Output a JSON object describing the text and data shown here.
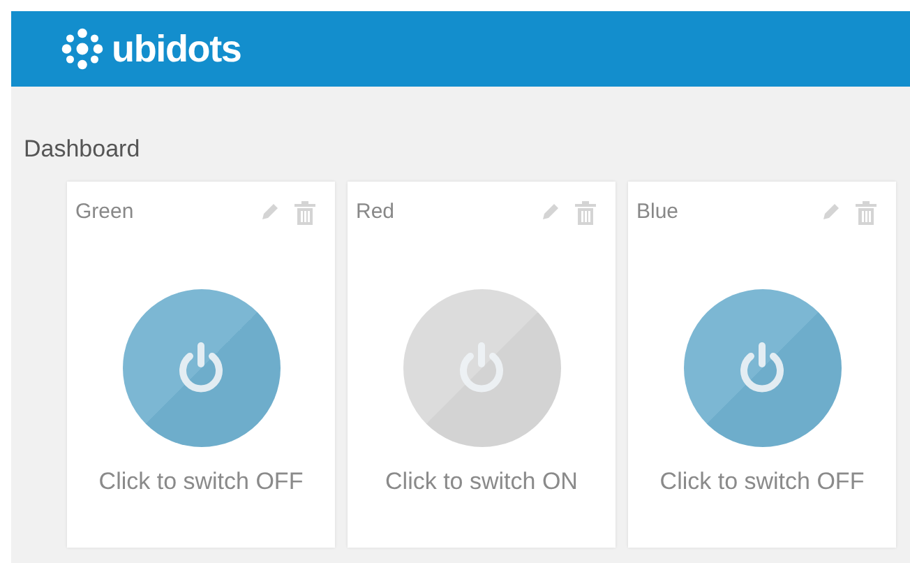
{
  "header": {
    "logo_text": "ubidots"
  },
  "page_title": "Dashboard",
  "widgets": [
    {
      "title": "Green",
      "on": true,
      "action": "Click to switch OFF"
    },
    {
      "title": "Red",
      "on": false,
      "action": "Click to switch ON"
    },
    {
      "title": "Blue",
      "on": true,
      "action": "Click to switch OFF"
    }
  ]
}
